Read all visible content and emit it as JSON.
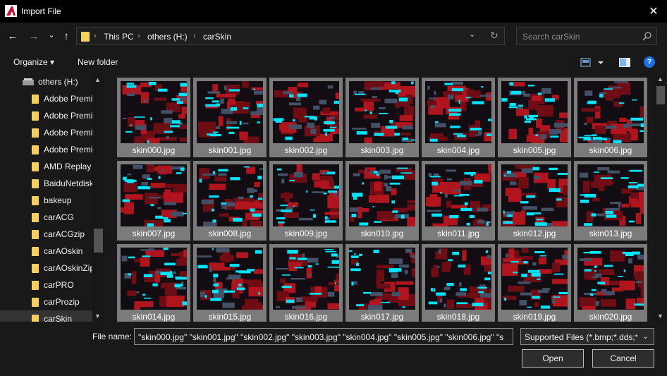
{
  "window": {
    "title": "Import File",
    "close_glyph": "✕"
  },
  "nav": {
    "back_glyph": "←",
    "forward_glyph": "→",
    "recent_glyph": "⌄",
    "up_glyph": "↑",
    "breadcrumb": [
      "This PC",
      "others (H:)",
      "carSkin"
    ],
    "sep_glyph": "›",
    "dropdown_glyph": "⌄",
    "refresh_glyph": "↻"
  },
  "search": {
    "placeholder": "Search carSkin"
  },
  "toolbar": {
    "organize": "Organize ▾",
    "new_folder": "New folder",
    "help_glyph": "?"
  },
  "sidebar": {
    "drive": "others (H:)",
    "items": [
      "Adobe Premi",
      "Adobe Premi",
      "Adobe Premi",
      "Adobe Premi",
      "AMD Replay",
      "BaiduNetdisk",
      "bakeup",
      "carACG",
      "carACGzip",
      "carAOskin",
      "carAOskinZip",
      "carPRO",
      "carProzip",
      "carSkin"
    ],
    "selected_index": 13
  },
  "files": [
    "skin000.jpg",
    "skin001.jpg",
    "skin002.jpg",
    "skin003.jpg",
    "skin004.jpg",
    "skin005.jpg",
    "skin006.jpg",
    "skin007.jpg",
    "skin008.jpg",
    "skin009.jpg",
    "skin010.jpg",
    "skin011.jpg",
    "skin012.jpg",
    "skin013.jpg",
    "skin014.jpg",
    "skin015.jpg",
    "skin016.jpg",
    "skin017.jpg",
    "skin018.jpg",
    "skin019.jpg",
    "skin020.jpg"
  ],
  "bottom": {
    "file_name_label": "File name:",
    "file_name_value": "\"skin000.jpg\" \"skin001.jpg\" \"skin002.jpg\" \"skin003.jpg\" \"skin004.jpg\" \"skin005.jpg\" \"skin006.jpg\" \"s",
    "filter_value": "Supported Files (*.bmp;*.dds;*.e",
    "filter_arrow": "⌄",
    "open_label": "Open",
    "cancel_label": "Cancel"
  },
  "colors": {
    "accent": "#00e5ff",
    "thumb_red": "#b0151e",
    "folder": "#f7d15d"
  }
}
